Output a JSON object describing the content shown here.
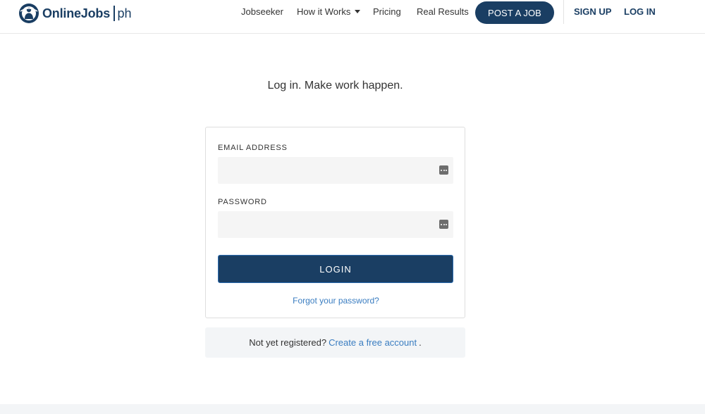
{
  "brand": {
    "name": "OnlineJobs",
    "suffix": "ph",
    "color": "#1a3e63"
  },
  "nav": {
    "jobseeker": "Jobseeker",
    "how_it_works": "How it Works",
    "pricing": "Pricing",
    "real_results": "Real Results",
    "post_job": "POST A JOB",
    "sign_up": "SIGN UP",
    "log_in": "LOG IN"
  },
  "headline": "Log in. Make work happen.",
  "form": {
    "email_label": "EMAIL ADDRESS",
    "email_value": "",
    "password_label": "PASSWORD",
    "password_value": "",
    "login_button": "LOGIN",
    "forgot_link": "Forgot your password?"
  },
  "register": {
    "prompt": "Not yet registered?",
    "link": "Create a free account",
    "end": "."
  },
  "colors": {
    "primary": "#1a3e63",
    "link": "#3a7dc1",
    "field_bg": "#f5f5f5"
  }
}
